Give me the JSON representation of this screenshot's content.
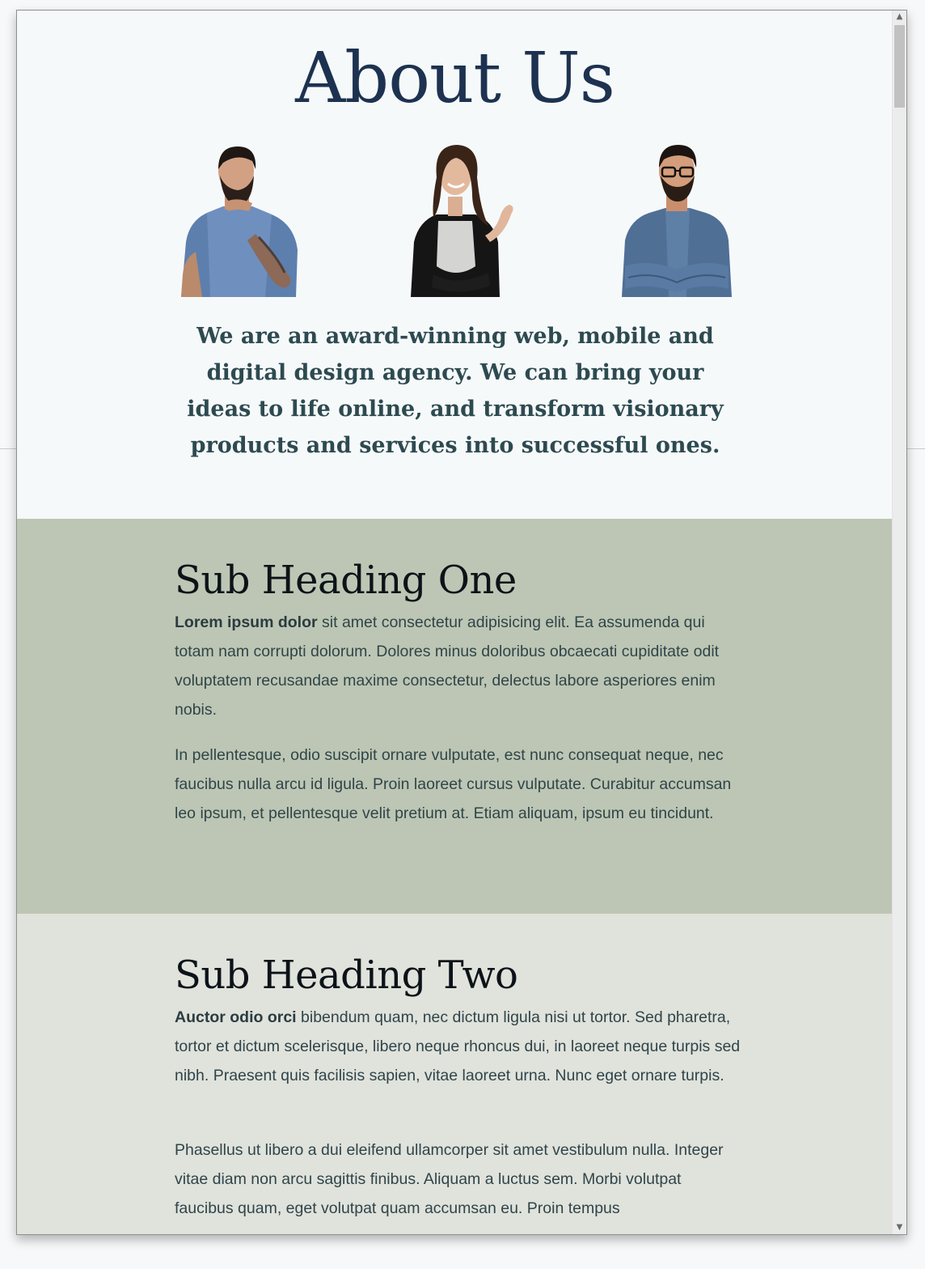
{
  "page": {
    "title": "About Us",
    "intro": "We are an award-winning web, mobile and digital design agency. We can bring your ideas to life online, and transform visionary products and services into successful ones."
  },
  "team": [
    {
      "icon": "bearded-man-thinking-photo"
    },
    {
      "icon": "smiling-woman-photo"
    },
    {
      "icon": "man-with-glasses-arms-crossed-photo"
    }
  ],
  "sections": [
    {
      "heading": "Sub Heading One",
      "p1_bold": "Lorem ipsum dolor",
      "p1_rest": " sit amet consectetur adipisicing elit. Ea assumenda qui totam nam corrupti dolorum. Dolores minus doloribus obcaecati cupiditate odit voluptatem recusandae maxime consectetur, delectus labore asperiores enim nobis.",
      "p2": "In pellentesque, odio suscipit ornare vulputate, est nunc consequat neque, nec faucibus nulla arcu id ligula. Proin laoreet cursus vulputate. Curabitur accumsan leo ipsum, et pellentesque velit pretium at. Etiam aliquam, ipsum eu tincidunt."
    },
    {
      "heading": "Sub Heading Two",
      "p1_bold": "Auctor odio orci",
      "p1_rest": " bibendum quam, nec dictum ligula nisi ut tortor. Sed pharetra, tortor et dictum scelerisque, libero neque rhoncus dui, in laoreet neque turpis sed nibh. Praesent quis facilisis sapien, vitae laoreet urna. Nunc eget ornare turpis.",
      "p2": "Phasellus ut libero a dui eleifend ullamcorper sit amet vestibulum nulla. Integer vitae diam non arcu sagittis finibus. Aliquam a luctus sem. Morbi volutpat faucibus quam, eget volutpat quam accumsan eu. Proin tempus"
    }
  ],
  "colors": {
    "title": "#1d3250",
    "intro": "#2d4a50",
    "section_one_bg": "#bdc6b4",
    "section_two_bg": "#e0e2dc",
    "body_text": "#2f4549"
  },
  "scrollbar": {
    "up_icon": "scroll-up-arrow-icon",
    "down_icon": "scroll-down-arrow-icon"
  }
}
